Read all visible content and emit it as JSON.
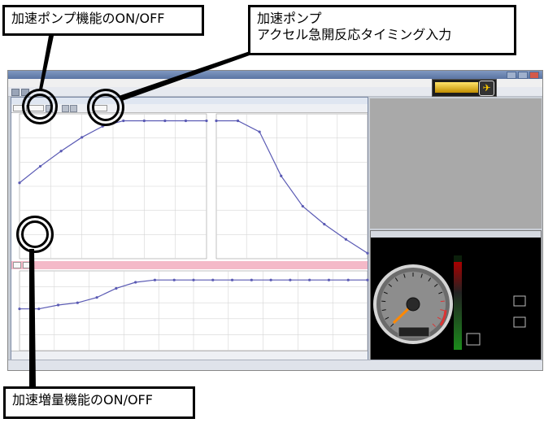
{
  "callouts": {
    "accel_pump_onoff": "加速ポンプ機能のON/OFF",
    "accel_pump_timing_line1": "加速ポンプ",
    "accel_pump_timing_line2": "アクセル急開反応タイミング入力",
    "accel_increase_onoff": "加速増量機能のON/OFF"
  },
  "colors": {
    "plot_line": "#5a5ab4",
    "pink_panel": "#f4b9c8",
    "callout_border": "#000000"
  },
  "icons": [
    "close-icon",
    "minimize-icon",
    "maximize-icon"
  ],
  "chart_data": [
    {
      "type": "line",
      "x": [
        0,
        1,
        2,
        3,
        4,
        5,
        6,
        7,
        8,
        9
      ],
      "values": [
        0.55,
        0.67,
        0.78,
        0.88,
        0.96,
        1.0,
        1.0,
        1.0,
        1.0,
        1.0
      ],
      "ylim": [
        0,
        1.05
      ],
      "grid": true
    },
    {
      "type": "line",
      "x": [
        0,
        1,
        2,
        3,
        4,
        5,
        6,
        7
      ],
      "values": [
        1.0,
        1.0,
        0.92,
        0.6,
        0.38,
        0.25,
        0.14,
        0.04
      ],
      "ylim": [
        0,
        1.05
      ],
      "grid": true
    },
    {
      "type": "line",
      "x": [
        0,
        1,
        2,
        3,
        4,
        5,
        6,
        7,
        8,
        9,
        10,
        11,
        12,
        13,
        14,
        15,
        16,
        17,
        18
      ],
      "values": [
        0.55,
        0.55,
        0.6,
        0.63,
        0.7,
        0.82,
        0.9,
        0.93,
        0.93,
        0.93,
        0.93,
        0.93,
        0.93,
        0.93,
        0.93,
        0.93,
        0.93,
        0.93,
        0.93
      ],
      "ylim": [
        0,
        1.05
      ],
      "grid": true
    }
  ]
}
